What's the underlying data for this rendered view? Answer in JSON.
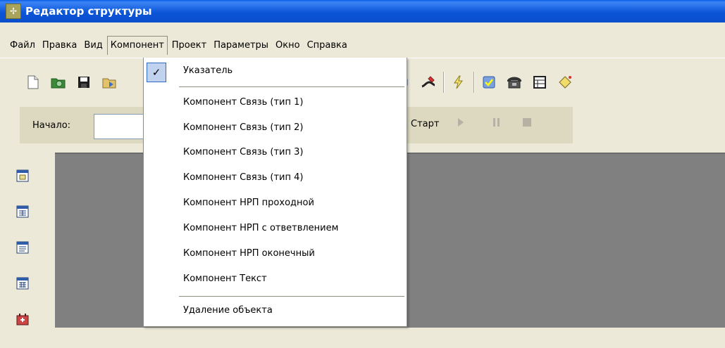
{
  "window": {
    "title": "Редактор структуры",
    "icon": "app-structure-icon"
  },
  "menubar": {
    "items": [
      "Файл",
      "Правка",
      "Вид",
      "Компонент",
      "Проект",
      "Параметры",
      "Окно",
      "Справка"
    ],
    "active": "Компонент"
  },
  "toolbar": {
    "icons": [
      "new-file-icon",
      "open-file-icon",
      "save-icon",
      "save-as-icon",
      "paste-icon",
      "box-3d-icon",
      "paint-icon",
      "lightning-icon",
      "check-box-icon",
      "phone-icon",
      "table-icon",
      "diamond-icon"
    ]
  },
  "runbar": {
    "start_label": "Начало:",
    "start_value": "",
    "start_button": "Старт",
    "play_icon": "play-icon",
    "pause_icon": "pause-icon",
    "stop_icon": "stop-icon"
  },
  "left_tools": [
    "form-icon",
    "table-form-icon",
    "list-form-icon",
    "grid-form-icon",
    "add-component-icon"
  ],
  "component_menu": {
    "items": [
      {
        "label": "Указатель",
        "checked": true
      },
      {
        "label": "Компонент Связь (тип 1)"
      },
      {
        "label": "Компонент Связь (тип 2)"
      },
      {
        "label": "Компонент Связь (тип 3)"
      },
      {
        "label": "Компонент Связь (тип 4)"
      },
      {
        "label": "Компонент НРП проходной"
      },
      {
        "label": "Компонент НРП с ответвлением"
      },
      {
        "label": "Компонент НРП оконечный"
      },
      {
        "label": "Компонент Текст"
      },
      {
        "label": "Удаление объекта"
      }
    ],
    "check_mark": "✓"
  },
  "colors": {
    "titlebar": "#0a55d8",
    "chrome": "#ece9d8",
    "runbar": "#ddd9c0",
    "workspace": "#808080",
    "menu_highlight": "#c1d2ee"
  }
}
